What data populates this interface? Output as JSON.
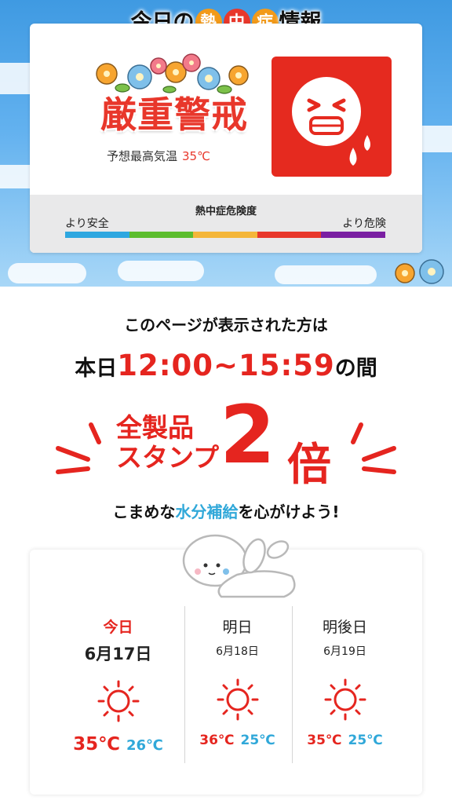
{
  "hero": {
    "title_part1": "今日の",
    "badge1": "熱",
    "badge2": "中",
    "badge3": "症",
    "title_part2": "情報",
    "alert_level": "厳重警戒",
    "temp_label": "予想最高気温",
    "temp_value": "35℃",
    "scale": {
      "title": "熱中症危険度",
      "left_label": "より安全",
      "right_label": "より危険",
      "colors": [
        "#2ea7e0",
        "#5cbd2e",
        "#f4b63a",
        "#e8372b",
        "#7a1fa2"
      ]
    }
  },
  "promo": {
    "line1": "このページが表示された方は",
    "prefix": "本日",
    "time": "12:00~15:59",
    "suffix": "の間",
    "stamp_line1": "全製品",
    "stamp_line2": "スタンプ",
    "multiplier": "2",
    "multiplier_unit": "倍",
    "hydrate_prefix": "こまめな",
    "hydrate_highlight": "水分補給",
    "hydrate_suffix": "を心がけよう!"
  },
  "forecast": {
    "days": [
      {
        "label": "今日",
        "date": "6月17日",
        "high": "35℃",
        "low": "26℃",
        "icon": "sun-icon"
      },
      {
        "label": "明日",
        "date": "6月18日",
        "high": "36℃",
        "low": "25℃",
        "icon": "sun-icon"
      },
      {
        "label": "明後日",
        "date": "6月19日",
        "high": "35℃",
        "low": "25℃",
        "icon": "sun-icon"
      }
    ]
  },
  "colors": {
    "accent_red": "#e5251f",
    "accent_blue": "#30a8d9",
    "sky": "#4fa7e8"
  }
}
